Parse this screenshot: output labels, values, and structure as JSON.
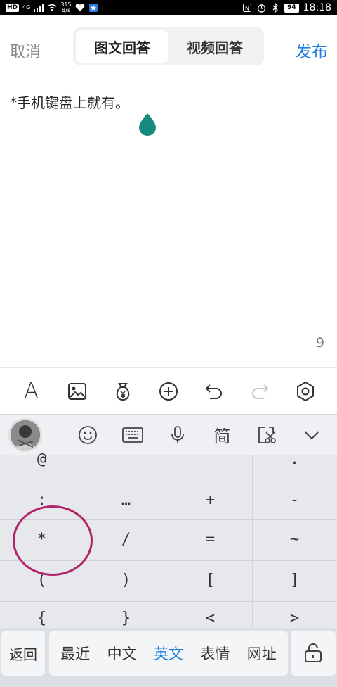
{
  "status_bar": {
    "hd": "HD",
    "signal": "4G",
    "net_speed_value": "315",
    "net_speed_unit": "B/s",
    "battery": "94",
    "time": "18:18"
  },
  "topbar": {
    "cancel": "取消",
    "tabs": [
      "图文回答",
      "视频回答"
    ],
    "active_tab": "图文回答",
    "publish": "发布"
  },
  "editor": {
    "content": "*手机键盘上就有。",
    "char_count": "9"
  },
  "format_toolbar": {
    "text_style": "A"
  },
  "keyboard_toolbar": {
    "simplified": "简"
  },
  "symbols": [
    [
      "@",
      "",
      "",
      "."
    ],
    [
      ":",
      "…",
      "+",
      "-"
    ],
    [
      "*",
      "/",
      "=",
      "~"
    ],
    [
      "(",
      ")",
      "[",
      "]"
    ],
    [
      "{",
      "}",
      "<",
      ">"
    ]
  ],
  "bottom": {
    "back": "返回",
    "categories": [
      "最近",
      "中文",
      "英文",
      "表情",
      "网址"
    ],
    "active_category": "英文"
  },
  "colors": {
    "accent": "#1f7fe0",
    "highlight_circle": "#b0256a",
    "cursor_handle": "#168a7e"
  }
}
